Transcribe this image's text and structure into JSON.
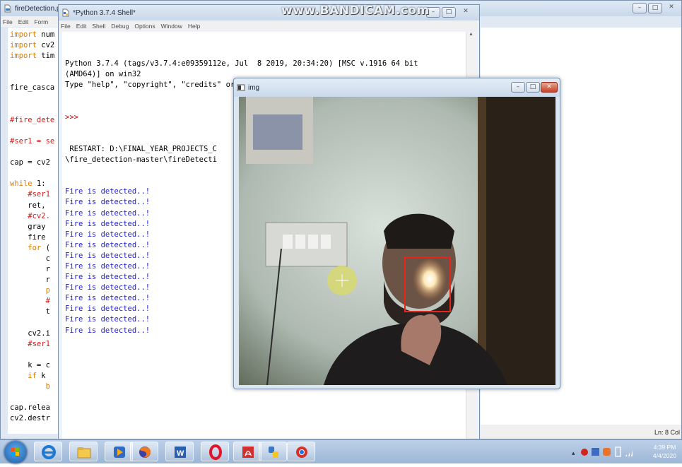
{
  "editor": {
    "title": "fireDetection.p",
    "menu": [
      "File",
      "Edit",
      "Form"
    ],
    "lines": [
      {
        "parts": [
          {
            "c": "kw",
            "t": "import"
          },
          {
            "c": "df",
            "t": " num"
          }
        ]
      },
      {
        "parts": [
          {
            "c": "kw",
            "t": "import"
          },
          {
            "c": "df",
            "t": " cv2"
          }
        ]
      },
      {
        "parts": [
          {
            "c": "kw",
            "t": "import"
          },
          {
            "c": "df",
            "t": " tim"
          }
        ]
      },
      {
        "parts": [
          {
            "c": "df",
            "t": ""
          }
        ]
      },
      {
        "parts": [
          {
            "c": "df",
            "t": ""
          }
        ]
      },
      {
        "parts": [
          {
            "c": "df",
            "t": "fire_casca"
          }
        ]
      },
      {
        "parts": [
          {
            "c": "df",
            "t": ""
          }
        ]
      },
      {
        "parts": [
          {
            "c": "df",
            "t": ""
          }
        ]
      },
      {
        "parts": [
          {
            "c": "cm",
            "t": "#fire_dete"
          }
        ]
      },
      {
        "parts": [
          {
            "c": "df",
            "t": ""
          }
        ]
      },
      {
        "parts": [
          {
            "c": "cm",
            "t": "#ser1 = se"
          }
        ]
      },
      {
        "parts": [
          {
            "c": "df",
            "t": ""
          }
        ]
      },
      {
        "parts": [
          {
            "c": "df",
            "t": "cap = cv2"
          }
        ]
      },
      {
        "parts": [
          {
            "c": "df",
            "t": ""
          }
        ]
      },
      {
        "parts": [
          {
            "c": "kw",
            "t": "while"
          },
          {
            "c": "df",
            "t": " 1:"
          }
        ]
      },
      {
        "parts": [
          {
            "c": "cm",
            "t": "    #ser1"
          }
        ]
      },
      {
        "parts": [
          {
            "c": "df",
            "t": "    ret, "
          }
        ]
      },
      {
        "parts": [
          {
            "c": "cm",
            "t": "    #cv2."
          }
        ]
      },
      {
        "parts": [
          {
            "c": "df",
            "t": "    gray "
          }
        ]
      },
      {
        "parts": [
          {
            "c": "df",
            "t": "    fire "
          }
        ]
      },
      {
        "parts": [
          {
            "c": "kw",
            "t": "    for"
          },
          {
            "c": "df",
            "t": " ("
          }
        ]
      },
      {
        "parts": [
          {
            "c": "df",
            "t": "        c"
          }
        ]
      },
      {
        "parts": [
          {
            "c": "df",
            "t": "        r"
          }
        ]
      },
      {
        "parts": [
          {
            "c": "df",
            "t": "        r"
          }
        ]
      },
      {
        "parts": [
          {
            "c": "kw",
            "t": "        p"
          }
        ]
      },
      {
        "parts": [
          {
            "c": "cm",
            "t": "        #"
          }
        ]
      },
      {
        "parts": [
          {
            "c": "df",
            "t": "        t"
          }
        ]
      },
      {
        "parts": [
          {
            "c": "df",
            "t": ""
          }
        ]
      },
      {
        "parts": [
          {
            "c": "df",
            "t": "    cv2.i"
          }
        ]
      },
      {
        "parts": [
          {
            "c": "cm",
            "t": "    #ser1"
          }
        ]
      },
      {
        "parts": [
          {
            "c": "df",
            "t": ""
          }
        ]
      },
      {
        "parts": [
          {
            "c": "df",
            "t": "    k = c"
          }
        ]
      },
      {
        "parts": [
          {
            "c": "kw",
            "t": "    if"
          },
          {
            "c": "df",
            "t": " k "
          }
        ]
      },
      {
        "parts": [
          {
            "c": "kw",
            "t": "        b"
          }
        ]
      },
      {
        "parts": [
          {
            "c": "df",
            "t": ""
          }
        ]
      },
      {
        "parts": [
          {
            "c": "df",
            "t": "cap.relea"
          }
        ]
      },
      {
        "parts": [
          {
            "c": "df",
            "t": "cv2.destr"
          }
        ]
      }
    ],
    "status": "Ln: 8  Col"
  },
  "shell": {
    "title": "*Python 3.7.4 Shell*",
    "menu": [
      "File",
      "Edit",
      "Shell",
      "Debug",
      "Options",
      "Window",
      "Help"
    ],
    "header_lines": [
      "Python 3.7.4 (tags/v3.7.4:e09359112e, Jul  8 2019, 20:34:20) [MSC v.1916 64 bit",
      "(AMD64)] on win32",
      "Type \"help\", \"copyright\", \"credits\" or \"license()\" for more information."
    ],
    "prompt": ">>> ",
    "restart_lines": [
      " RESTART: D:\\FINAL_YEAR_PROJECTS_C",
      "\\fire_detection-master\\fireDetecti"
    ],
    "output_lines": [
      "Fire is detected..!",
      "Fire is detected..!",
      "Fire is detected..!",
      "Fire is detected..!",
      "Fire is detected..!",
      "Fire is detected..!",
      "Fire is detected..!",
      "Fire is detected..!",
      "Fire is detected..!",
      "Fire is detected..!",
      "Fire is detected..!",
      "Fire is detected..!",
      "Fire is detected..!",
      "Fire is detected..!"
    ]
  },
  "img_window": {
    "title": "img"
  },
  "watermark": "www.BANDICAM.com",
  "taskbar": {
    "apps": [
      "start",
      "internet-explorer",
      "file-explorer",
      "media-player",
      "firefox",
      "word",
      "opera",
      "acrobat",
      "python",
      "chrome"
    ],
    "clock_time": "4:39 PM",
    "clock_date": "4/4/2020"
  },
  "colors": {
    "detection_box": "#e8251a",
    "shell_output": "#2222cc",
    "keyword": "#e07b00",
    "comment": "#d01b1b"
  }
}
